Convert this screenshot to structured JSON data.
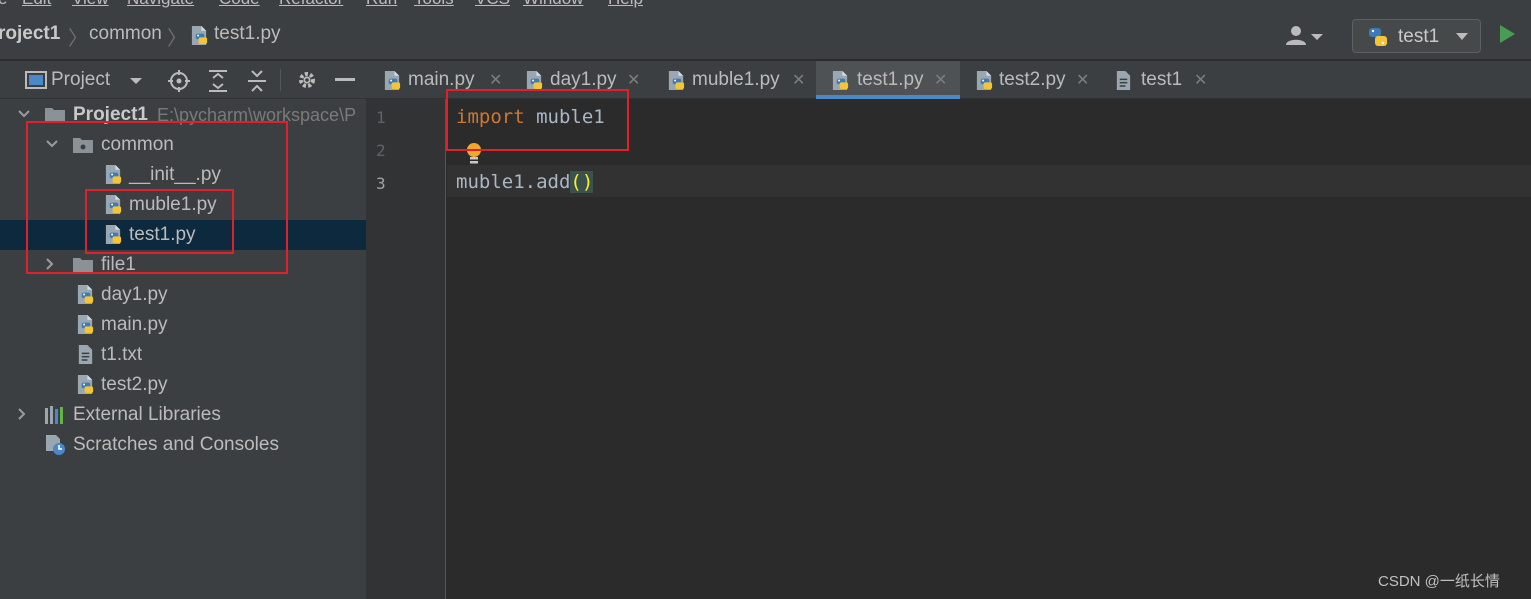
{
  "menubar": {
    "items": [
      "e",
      "Edit",
      "View",
      "Navigate",
      "Code",
      "Refactor",
      "Run",
      "Tools",
      "VCS",
      "Window",
      "Help"
    ]
  },
  "navbar": {
    "crumbs": [
      "roject1",
      "common",
      "test1.py"
    ],
    "run_config": "test1"
  },
  "project_panel": {
    "title": "Project",
    "tree": [
      {
        "label": "Project1",
        "path": "E:\\pycharm\\workspace\\P"
      },
      {
        "label": "common"
      },
      {
        "label": "__init__.py"
      },
      {
        "label": "muble1.py"
      },
      {
        "label": "test1.py"
      },
      {
        "label": "file1"
      },
      {
        "label": "day1.py"
      },
      {
        "label": "main.py"
      },
      {
        "label": "t1.txt"
      },
      {
        "label": "test2.py"
      },
      {
        "label": "External Libraries"
      },
      {
        "label": "Scratches and Consoles"
      }
    ]
  },
  "tabs": [
    {
      "label": "main.py"
    },
    {
      "label": "day1.py"
    },
    {
      "label": "muble1.py"
    },
    {
      "label": "test1.py"
    },
    {
      "label": "test2.py"
    },
    {
      "label": "test1"
    }
  ],
  "editor": {
    "line_numbers": [
      "1",
      "2",
      "3"
    ],
    "line1_keyword": "import",
    "line1_rest": " muble1",
    "line3_call": "muble1.add",
    "line3_parens": "()"
  },
  "colors": {
    "keyword": "#cc7832",
    "identifier": "#a9b7c6",
    "selection": "#0d293e",
    "annotation": "#e0202a",
    "active_tab_underline": "#4a88c7",
    "run_green": "#499c54"
  },
  "icons": {
    "py_file": "python-file-icon",
    "folder": "folder-icon",
    "text_file": "text-file-icon",
    "libraries": "libraries-icon",
    "scratches": "scratches-icon"
  },
  "watermark": "CSDN @一纸长情"
}
